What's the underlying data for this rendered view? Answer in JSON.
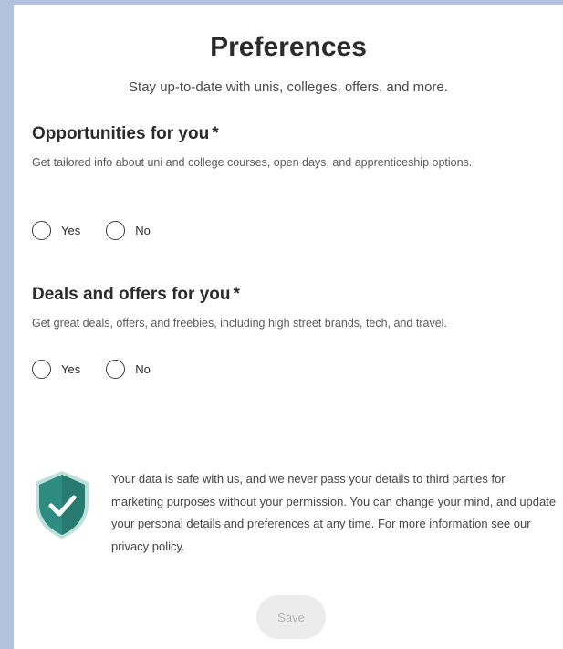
{
  "header": {
    "title": "Preferences",
    "subtitle": "Stay up-to-date with unis, colleges, offers, and more."
  },
  "sections": [
    {
      "heading": "Opportunities for you",
      "required_marker": "*",
      "description": "Get tailored info about uni and college courses, open days, and apprenticeship options.",
      "options": [
        "Yes",
        "No"
      ],
      "selected": null
    },
    {
      "heading": "Deals and offers for you",
      "required_marker": "*",
      "description": "Get great deals, offers, and freebies, including high street brands, tech, and travel.",
      "options": [
        "Yes",
        "No"
      ],
      "selected": null
    }
  ],
  "privacy": {
    "icon": "shield-check-icon",
    "text": "Your data is safe with us, and we never pass your details to third parties for marketing purposes without your permission. You can change your mind, and update your personal details and preferences at any time. For more information see our privacy policy."
  },
  "actions": {
    "save_label": "Save"
  },
  "colors": {
    "page_background": "#b3c1dc",
    "shield_fill": "#2e8b80",
    "save_button_bg": "#ececec",
    "save_button_text": "#b5b5b5"
  }
}
